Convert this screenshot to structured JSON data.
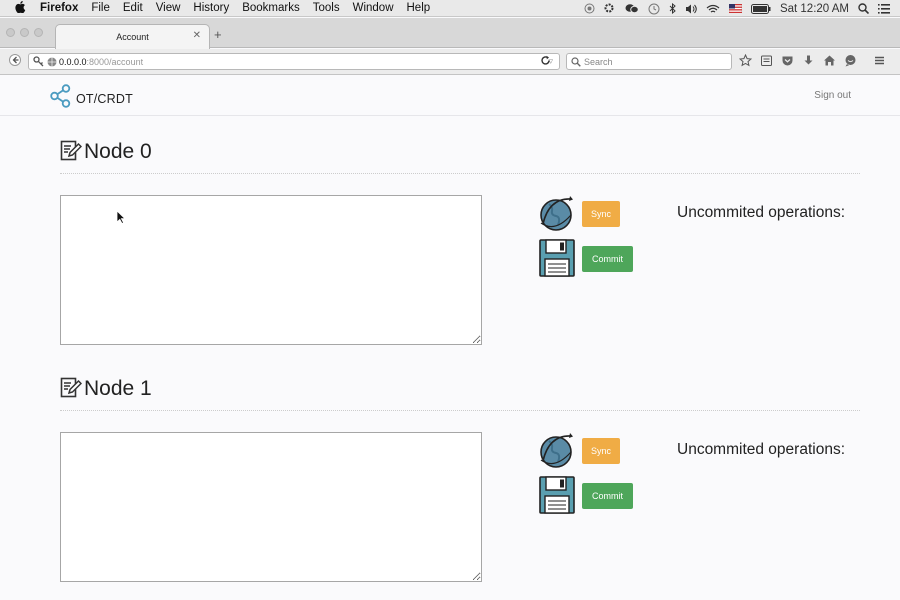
{
  "menubar": {
    "app": "Firefox",
    "items": [
      "File",
      "Edit",
      "View",
      "History",
      "Bookmarks",
      "Tools",
      "Window",
      "Help"
    ],
    "clock": "Sat 12:20 AM"
  },
  "browser": {
    "tab_title": "Account",
    "url_host": "0.0.0.0",
    "url_rest": ":8000/account",
    "search_placeholder": "Search"
  },
  "page": {
    "brand": "OT/CRDT",
    "signout": "Sign out"
  },
  "nodes": [
    {
      "title": "Node 0",
      "editor_value": "",
      "sync_label": "Sync",
      "commit_label": "Commit",
      "uncommitted_label": "Uncommited operations:"
    },
    {
      "title": "Node 1",
      "editor_value": "",
      "sync_label": "Sync",
      "commit_label": "Commit",
      "uncommitted_label": "Uncommited operations:"
    }
  ],
  "colors": {
    "sync": "#f0ac45",
    "commit": "#4ea65a",
    "brand_icon": "#4a9bc0"
  }
}
